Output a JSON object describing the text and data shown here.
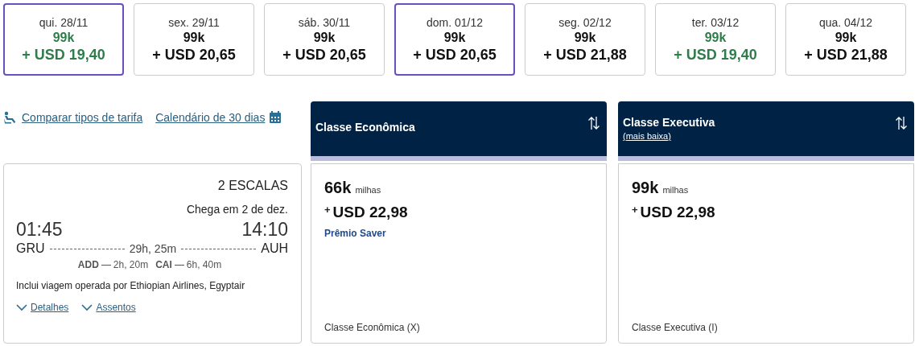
{
  "date_strip": [
    {
      "date": "qui. 28/11",
      "miles": "99k",
      "price": "+ USD 19,40",
      "selected": true,
      "lowest": true
    },
    {
      "date": "sex. 29/11",
      "miles": "99k",
      "price": "+ USD 20,65",
      "selected": false,
      "lowest": false
    },
    {
      "date": "sáb. 30/11",
      "miles": "99k",
      "price": "+ USD 20,65",
      "selected": false,
      "lowest": false
    },
    {
      "date": "dom. 01/12",
      "miles": "99k",
      "price": "+ USD 20,65",
      "selected": true,
      "lowest": false
    },
    {
      "date": "seg. 02/12",
      "miles": "99k",
      "price": "+ USD 21,88",
      "selected": false,
      "lowest": false
    },
    {
      "date": "ter. 03/12",
      "miles": "99k",
      "price": "+ USD 19,40",
      "selected": false,
      "lowest": true
    },
    {
      "date": "qua. 04/12",
      "miles": "99k",
      "price": "+ USD 21,88",
      "selected": false,
      "lowest": false
    }
  ],
  "tools": [
    {
      "label": "Comparar tipos de tarifa",
      "kind": "seat"
    },
    {
      "label": "Calendário de 30 dias",
      "kind": "calendar"
    }
  ],
  "flight": {
    "stops": "2 ESCALAS",
    "arrival_note": "Chega em 2 de dez.",
    "depart_time": "01:45",
    "arrive_time": "14:10",
    "origin": "GRU",
    "destination": "AUH",
    "duration": "29h, 25m",
    "layovers": [
      {
        "airport": "ADD",
        "duration": "2h, 20m"
      },
      {
        "airport": "CAI",
        "duration": "6h, 40m"
      }
    ],
    "operated_by": "Inclui viagem operada por Ethiopian Airlines, Egyptair",
    "links": [
      {
        "label": "Detalhes",
        "expanded": false
      },
      {
        "label": "Assentos",
        "expanded": false
      }
    ]
  },
  "fare_columns": [
    {
      "title": "Classe Econômica",
      "miles": "66k",
      "miles_unit": "milhas",
      "price_prefix": "+",
      "price": "USD 22,98",
      "badge": "Prêmio Saver",
      "cabin": "Classe Econômica (X)"
    },
    {
      "title": "Classe Executiva",
      "subtitle": "(mais baixa)",
      "miles": "99k",
      "miles_unit": "milhas",
      "price_prefix": "+",
      "price": "USD 22,98",
      "cabin": "Classe Executiva (I)"
    }
  ]
}
